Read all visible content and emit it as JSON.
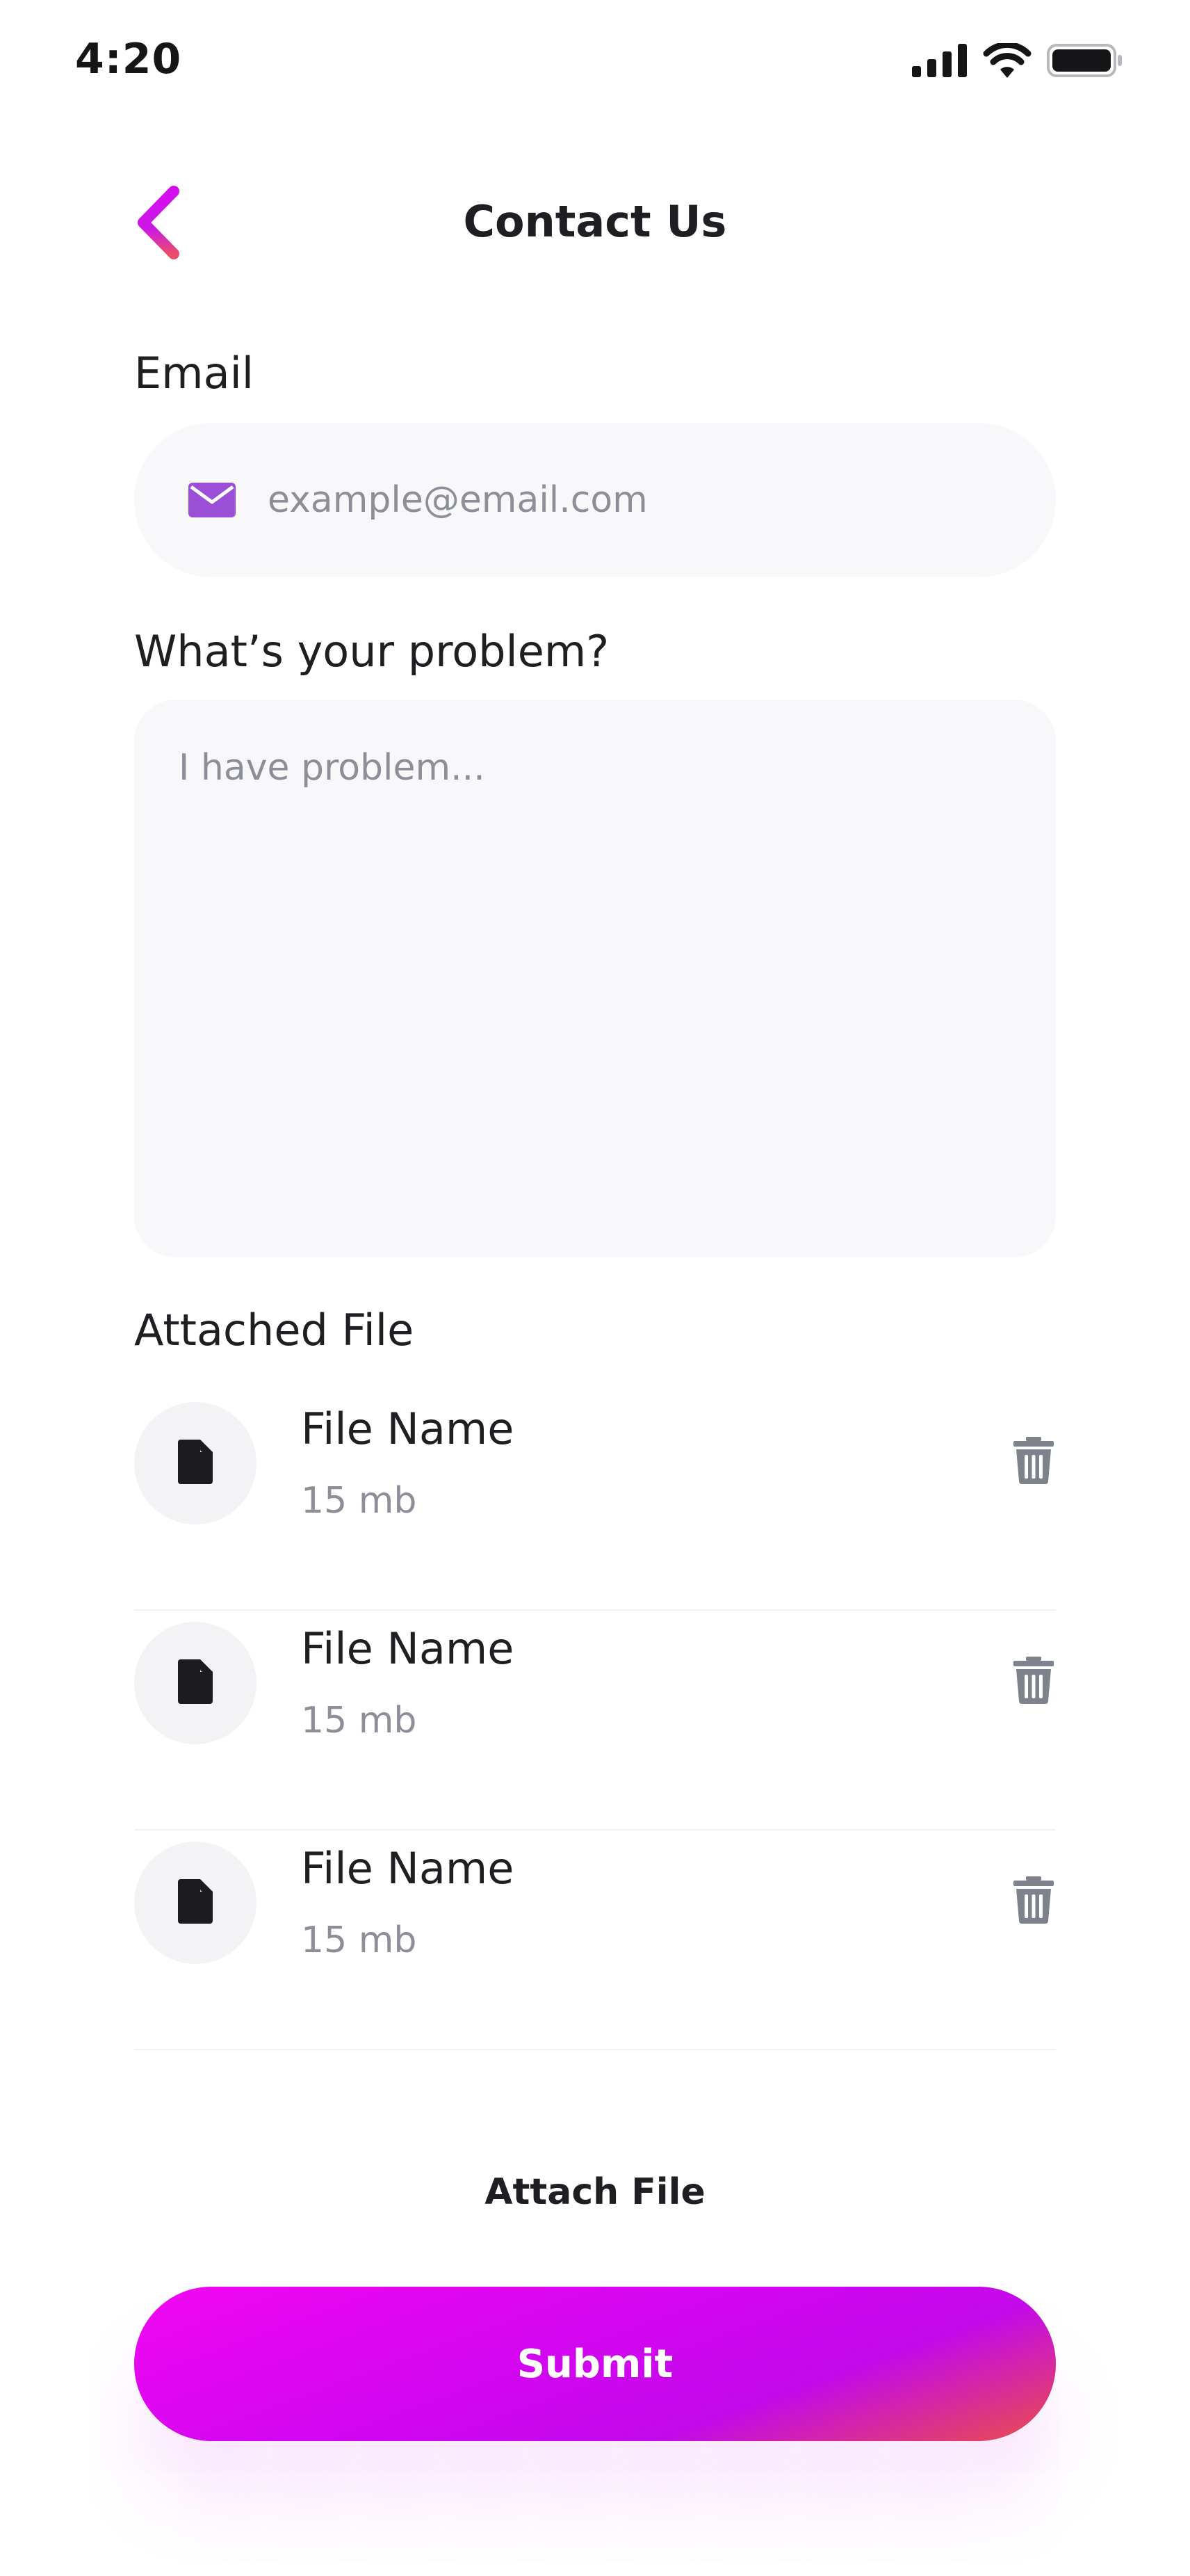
{
  "status_bar": {
    "time": "4:20",
    "icons": [
      "signal-icon",
      "wifi-icon",
      "battery-icon"
    ]
  },
  "header": {
    "title": "Contact Us",
    "back_icon": "chevron-left-icon"
  },
  "form": {
    "email": {
      "label": "Email",
      "placeholder": "example@email.com",
      "value": "",
      "icon": "mail-icon"
    },
    "problem": {
      "label": "What’s your problem?",
      "placeholder": "I have problem...",
      "value": ""
    }
  },
  "attachments": {
    "label": "Attached File",
    "files": [
      {
        "name": "File Name",
        "size": "15 mb"
      },
      {
        "name": "File Name",
        "size": "15 mb"
      },
      {
        "name": "File Name",
        "size": "15 mb"
      }
    ]
  },
  "actions": {
    "attach_label": "Attach File",
    "submit_label": "Submit"
  },
  "colors": {
    "accent_start": "#f007f0",
    "accent_mid": "#c309ea",
    "accent_end": "#ea4e4a",
    "mail_icon": "#9a4fd6",
    "field_background": "#f8f8fb",
    "muted_text": "#8c8e98",
    "trash_icon": "#7e828d"
  }
}
